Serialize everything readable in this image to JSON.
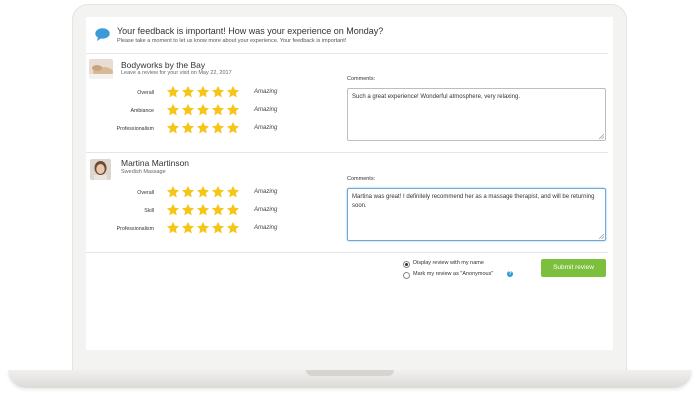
{
  "header": {
    "title": "Your feedback is important! How was your experience on Monday?",
    "subtitle": "Please take a moment to let us know more about your experience. Your feedback is important!",
    "icon": "chat-bubble-icon",
    "accent": "#3a9bd9"
  },
  "reviews": [
    {
      "name": "Bodyworks by the Bay",
      "subtitle": "Leave a review for your visit on May 22, 2017",
      "ratings": [
        {
          "label": "Overall",
          "stars": 5,
          "word": "Amazing"
        },
        {
          "label": "Ambiance",
          "stars": 5,
          "word": "Amazing"
        },
        {
          "label": "Professionalism",
          "stars": 5,
          "word": "Amazing"
        }
      ],
      "comments_label": "Comments:",
      "comment": "Such a great experience! Wonderful atmosphere, very relaxing."
    },
    {
      "name": "Martina Martinson",
      "subtitle": "Swedish Massage",
      "ratings": [
        {
          "label": "Overall",
          "stars": 5,
          "word": "Amazing"
        },
        {
          "label": "Skill",
          "stars": 5,
          "word": "Amazing"
        },
        {
          "label": "Professionalism",
          "stars": 5,
          "word": "Amazing"
        }
      ],
      "comments_label": "Comments:",
      "comment": "Martina was great! I definitely recommend her as a massage therapist, and will be returning soon."
    }
  ],
  "privacy": {
    "options": [
      {
        "label": "Display review with my name",
        "selected": true
      },
      {
        "label": "Mark my review as \"Anonymous\"",
        "selected": false
      }
    ],
    "help_icon": "question-icon"
  },
  "submit_label": "Submit review",
  "colors": {
    "star": "#f5c518",
    "submit": "#7bbf3d",
    "focus_border": "#6fa8d6"
  }
}
